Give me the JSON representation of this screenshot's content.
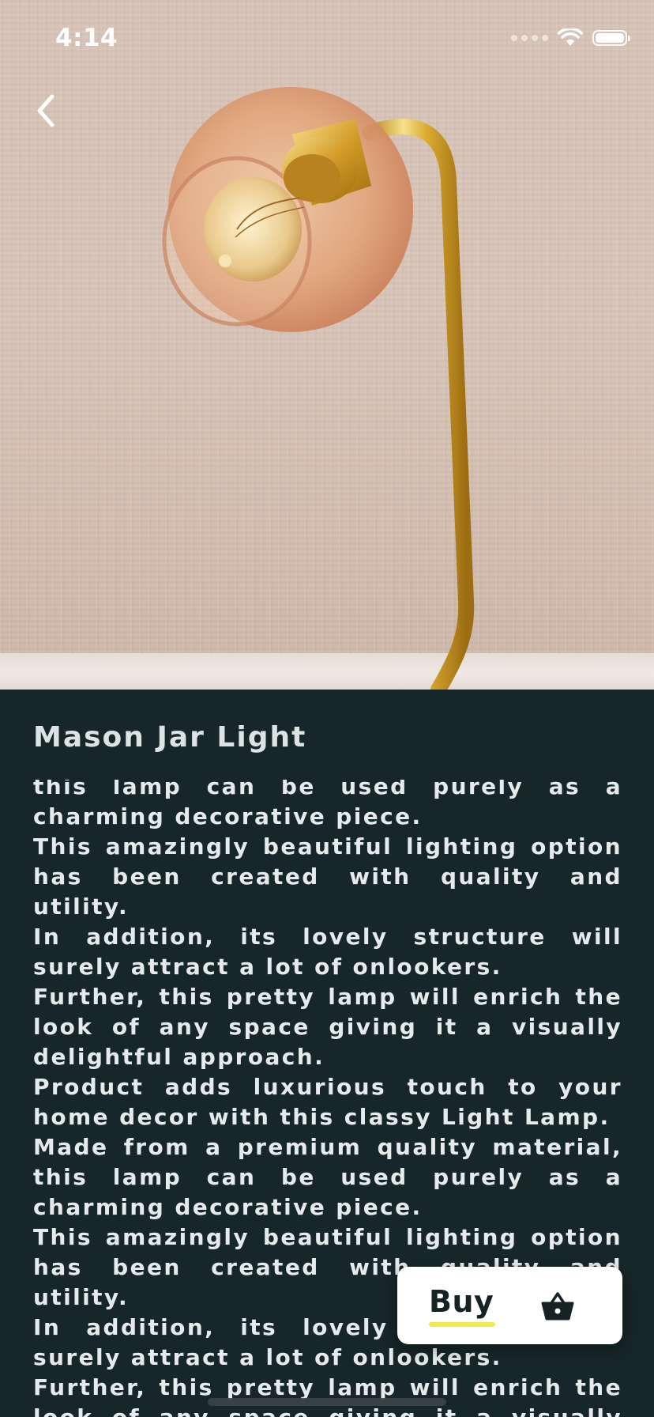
{
  "status_bar": {
    "time": "4:14"
  },
  "navigation": {
    "back_icon": "chevron-left-icon"
  },
  "product": {
    "title": "Mason Jar Light",
    "image_description_icon": "lamp-photo",
    "description": "this lamp can be used purely as a charming decorative piece.\nThis amazingly beautiful lighting option has been created with quality and utility.\nIn addition, its lovely structure will surely attract a lot of onlookers.\nFurther, this pretty lamp will enrich the look of any space giving it a visually delightful approach.\nProduct adds luxurious touch to your home decor with this classy Light Lamp.\nMade from a premium quality material, this lamp can be used purely as a charming decorative piece.\nThis amazingly beautiful lighting option has been created with quality and utility.\nIn addition, its lovely structure will surely attract a lot of onlookers.\nFurther, this pretty lamp will enrich the look of any space giving it a visually delightful approach."
  },
  "buy_button": {
    "label": "Buy",
    "icon": "basket-icon"
  },
  "colors": {
    "background": "#172628",
    "text": "#e6eaea",
    "accent_underline": "#f2e94e",
    "button": "#ffffff"
  }
}
